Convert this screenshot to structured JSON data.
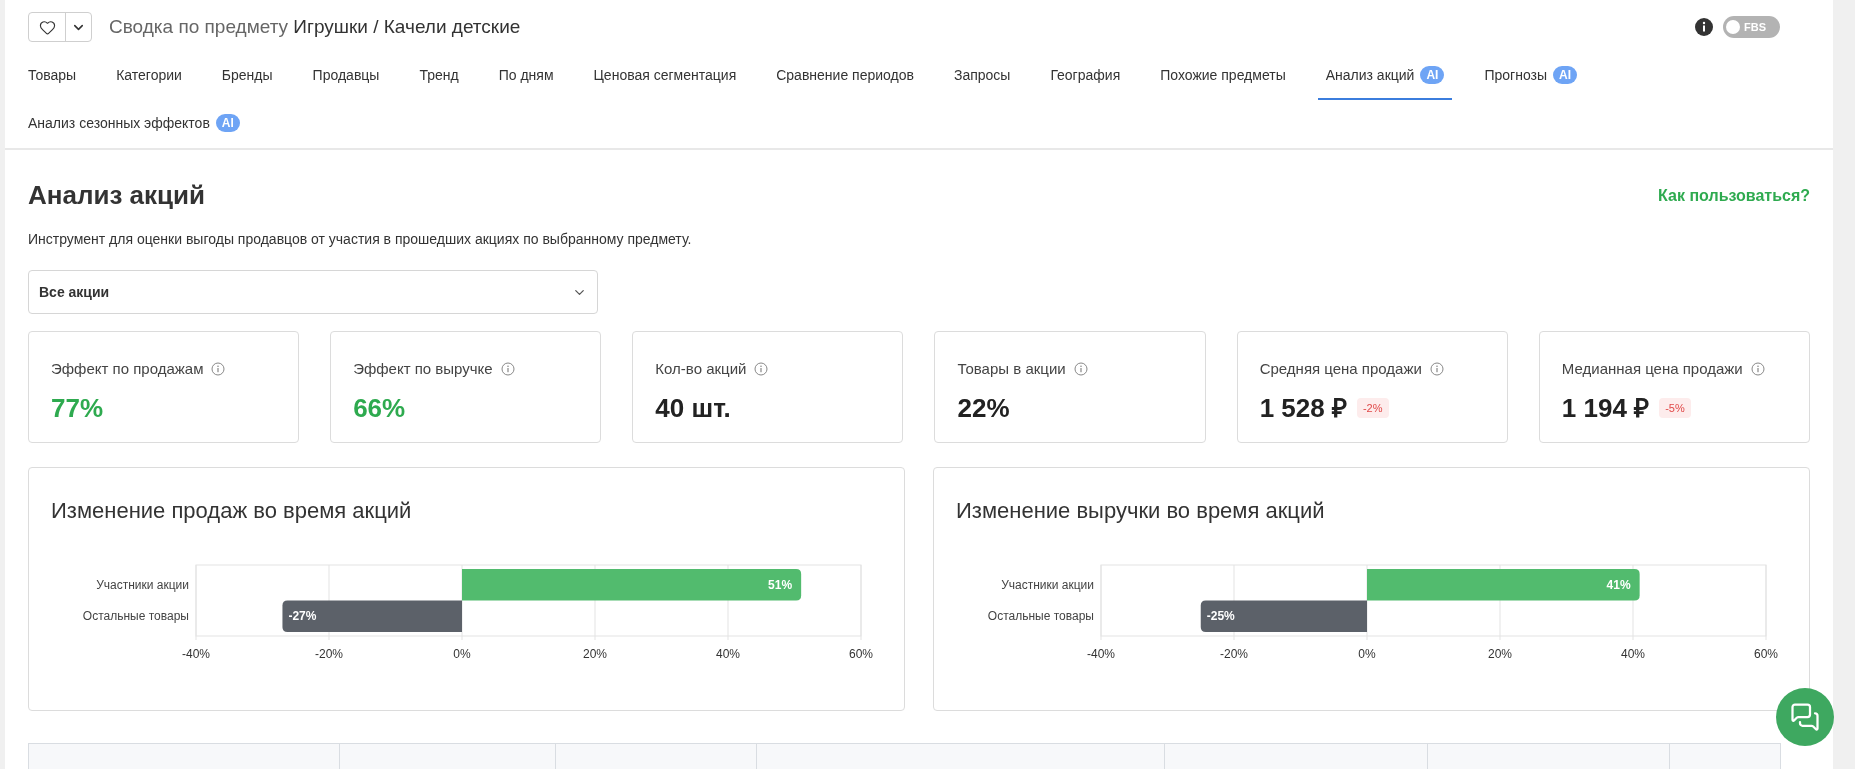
{
  "header": {
    "title_prefix": "Сводка по предмету",
    "title_subject": "Игрушки / Качели детские",
    "toggle": {
      "label": "FBS",
      "on": false
    }
  },
  "tabs": [
    {
      "label": "Товары",
      "selected": false
    },
    {
      "label": "Категории",
      "selected": false
    },
    {
      "label": "Бренды",
      "selected": false
    },
    {
      "label": "Продавцы",
      "selected": false
    },
    {
      "label": "Тренд",
      "selected": false
    },
    {
      "label": "По дням",
      "selected": false
    },
    {
      "label": "Ценовая сегментация",
      "selected": false
    },
    {
      "label": "Сравнение периодов",
      "selected": false
    },
    {
      "label": "Запросы",
      "selected": false
    },
    {
      "label": "География",
      "selected": false
    },
    {
      "label": "Похожие предметы",
      "selected": false
    },
    {
      "label": "Анализ акций",
      "badge": "AI",
      "selected": true
    },
    {
      "label": "Прогнозы",
      "badge": "AI",
      "selected": false
    },
    {
      "label": "Анализ сезонных эффектов",
      "badge": "AI",
      "selected": false
    }
  ],
  "page": {
    "heading": "Анализ акций",
    "help_link": "Как пользоваться?",
    "description": "Инструмент для оценки выгоды продавцов от участия в прошедших акциях по выбранному предмету."
  },
  "filter": {
    "value": "Все акции"
  },
  "metrics": [
    {
      "label": "Эффект по продажам",
      "value": "77%",
      "positive": true
    },
    {
      "label": "Эффект по выручке",
      "value": "66%",
      "positive": true
    },
    {
      "label": "Кол-во акций",
      "value": "40 шт.",
      "positive": false
    },
    {
      "label": "Товары в акции",
      "value": "22%",
      "positive": false
    },
    {
      "label": "Средняя цена продажи",
      "value": "1 528 ₽",
      "positive": false,
      "change": "-2%"
    },
    {
      "label": "Медианная цена продажи",
      "value": "1 194 ₽",
      "positive": false,
      "change": "-5%"
    }
  ],
  "charts": [
    {
      "title": "Изменение продаж во время акций",
      "chart_data": {
        "type": "bar",
        "orientation": "horizontal",
        "grid": true,
        "categories": [
          "Участники акции",
          "Остальные товары"
        ],
        "values": [
          51,
          -27
        ],
        "value_labels": [
          "51%",
          "-27%"
        ],
        "xlim": [
          -40,
          60
        ],
        "xticks": [
          {
            "value": -40,
            "label": "-40%"
          },
          {
            "value": -20,
            "label": "-20%"
          },
          {
            "value": 0,
            "label": "0%"
          },
          {
            "value": 20,
            "label": "20%"
          },
          {
            "value": 40,
            "label": "40%"
          },
          {
            "value": 60,
            "label": "60%"
          }
        ]
      }
    },
    {
      "title": "Изменение выручки во время акций",
      "chart_data": {
        "type": "bar",
        "orientation": "horizontal",
        "grid": true,
        "categories": [
          "Участники акции",
          "Остальные товары"
        ],
        "values": [
          41,
          -25
        ],
        "value_labels": [
          "41%",
          "-25%"
        ],
        "xlim": [
          -40,
          60
        ],
        "xticks": [
          {
            "value": -40,
            "label": "-40%"
          },
          {
            "value": -20,
            "label": "-20%"
          },
          {
            "value": 0,
            "label": "0%"
          },
          {
            "value": 20,
            "label": "20%"
          },
          {
            "value": 40,
            "label": "40%"
          },
          {
            "value": 60,
            "label": "60%"
          }
        ]
      }
    }
  ]
}
